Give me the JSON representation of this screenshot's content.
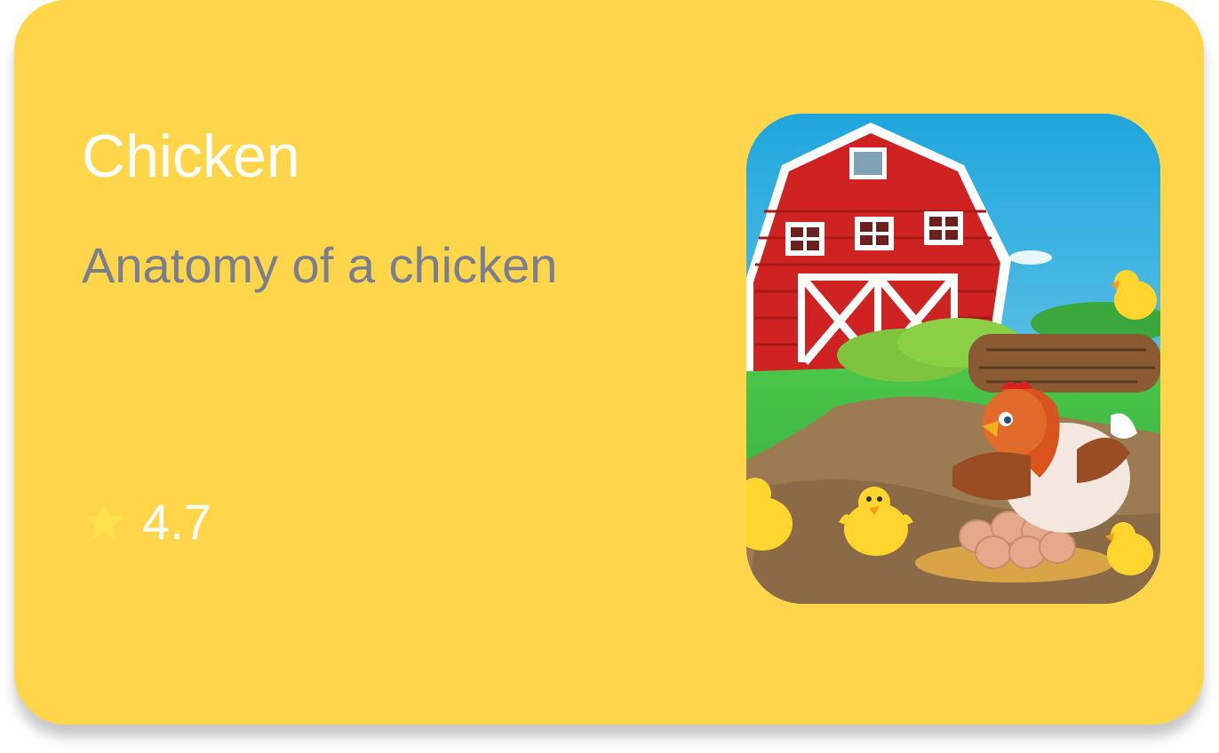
{
  "card": {
    "title": "Chicken",
    "subtitle": "Anatomy of a chicken",
    "rating": "4.7",
    "rating_icon": "star-icon",
    "image_alt": "farm scene with barn, hen and chicks",
    "colors": {
      "card_background": "#FFD54A",
      "title": "#FFFFFF",
      "subtitle": "#7A7E8E",
      "star": "#FFE14D"
    }
  }
}
